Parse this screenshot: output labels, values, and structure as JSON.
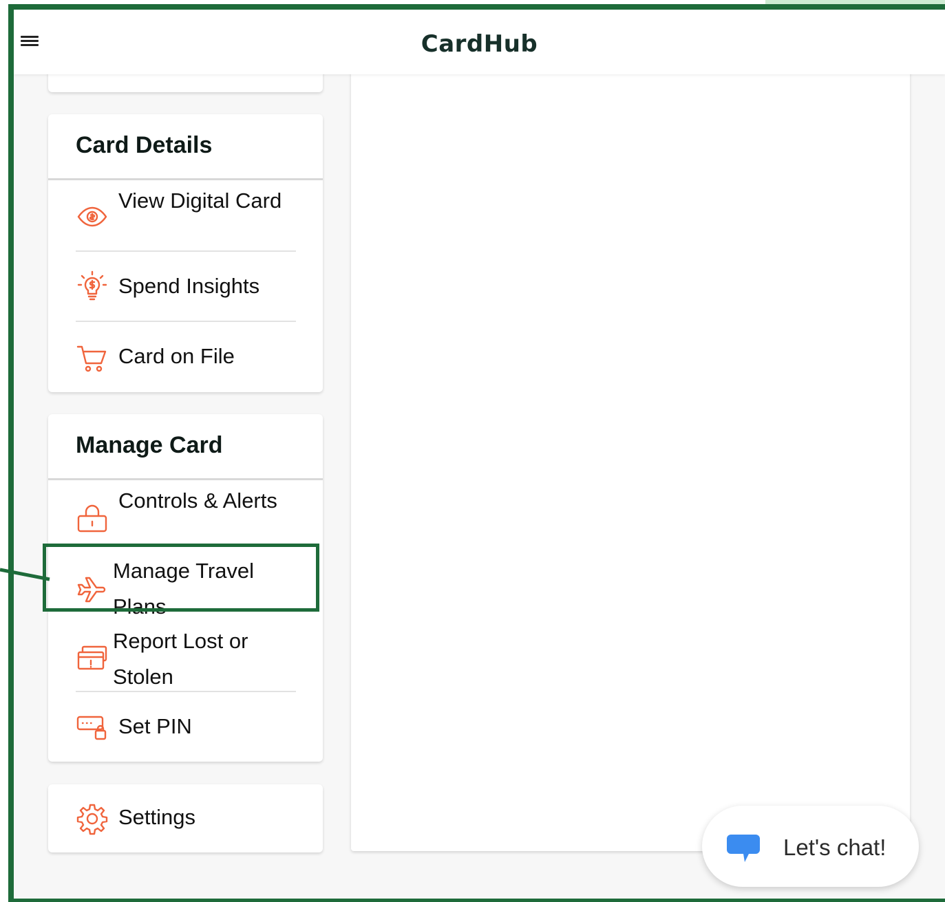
{
  "app": {
    "title": "CardHub"
  },
  "header": {
    "menu_icon": "hamburger-menu-icon"
  },
  "sections": {
    "card_details": {
      "title": "Card Details",
      "items": [
        {
          "label": "View Digital Card",
          "icon": "eye-icon"
        },
        {
          "label": "Spend Insights",
          "icon": "lightbulb-dollar-icon"
        },
        {
          "label": "Card on File",
          "icon": "shopping-cart-icon"
        }
      ]
    },
    "manage_card": {
      "title": "Manage Card",
      "items": [
        {
          "label": "Controls & Alerts",
          "icon": "lock-icon"
        },
        {
          "label": "Manage Travel Plans",
          "icon": "airplane-icon",
          "highlighted": true
        },
        {
          "label": "Report Lost or Stolen",
          "icon": "card-alert-icon"
        },
        {
          "label": "Set PIN",
          "icon": "pin-keypad-icon"
        }
      ]
    },
    "settings": {
      "label": "Settings",
      "icon": "gear-icon"
    }
  },
  "chat": {
    "label": "Let's chat!",
    "icon": "chat-bubble-icon"
  },
  "colors": {
    "accent": "#f0643c",
    "annotation": "#1e6b3a",
    "chat_icon": "#3b8cf0",
    "title": "#17302a"
  }
}
